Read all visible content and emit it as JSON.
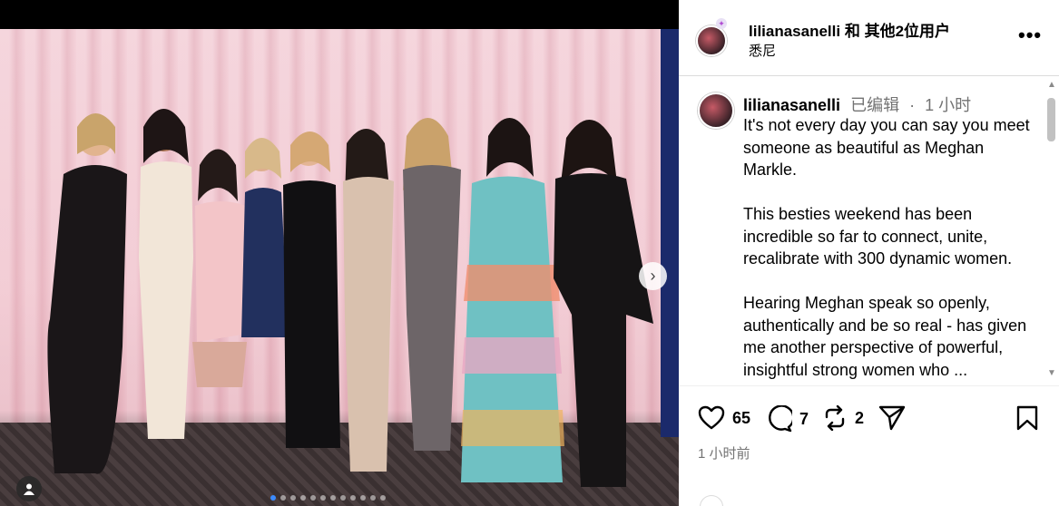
{
  "post": {
    "image_alt": "Group photo of nine women in front of a pink curtain",
    "carousel": {
      "slides": 12,
      "active_index": 0
    }
  },
  "header": {
    "username": "lilianasanelli",
    "collaborators": "和 其他2位用户",
    "location": "悉尼",
    "more_icon": "more-horizontal-icon"
  },
  "caption": {
    "username": "lilianasanelli",
    "edited": "已编辑",
    "dot": "·",
    "time": "1 小时",
    "paragraphs": [
      "It's not every day you can say you meet someone as beautiful as Meghan Markle.",
      "This besties weekend has been incredible so far to connect, unite, recalibrate with 300 dynamic women.",
      "Hearing Meghan speak so openly, authentically and be so real - has given me another perspective of powerful, insightful strong women who ..."
    ]
  },
  "actions": {
    "likes": "65",
    "comments": "7",
    "reposts": "2",
    "icons": [
      "heart-icon",
      "comment-icon",
      "repost-icon",
      "share-icon",
      "bookmark-icon"
    ]
  },
  "timestamp": "1 小时前",
  "colors": {
    "accent": "#3b8bff",
    "muted": "#737373",
    "divider": "#dbdbdb"
  }
}
